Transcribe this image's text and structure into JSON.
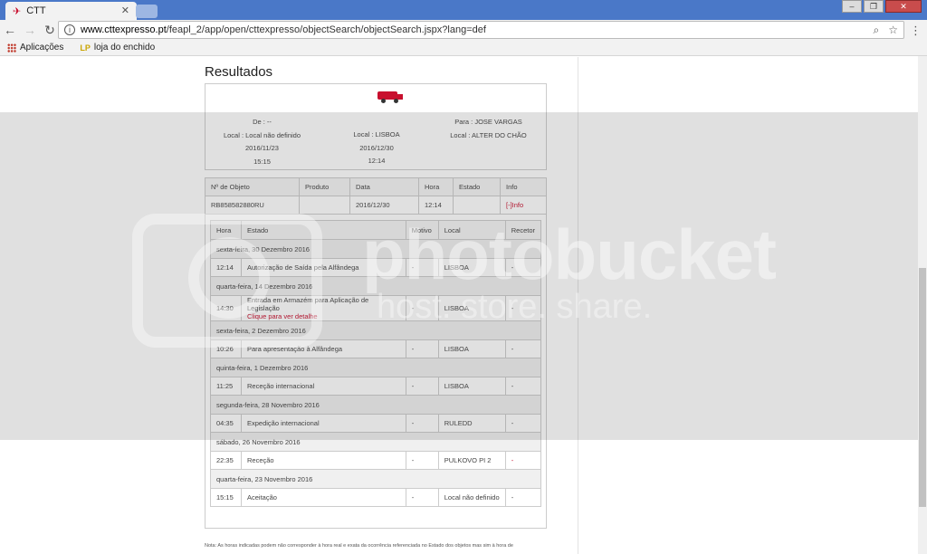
{
  "browser": {
    "tab_title": "CTT",
    "url_host": "www.cttexpresso.pt",
    "url_path": "/feapl_2/app/open/cttexpresso/objectSearch/objectSearch.jspx?lang=def",
    "bookmarks": [
      "Aplicações",
      "loja do enchido"
    ]
  },
  "page": {
    "title": "Resultados",
    "summary": {
      "origin": {
        "de": "De : --",
        "local": "Local : Local não definido",
        "date": "2016/11/23",
        "time": "15:15"
      },
      "current": {
        "local": "Local : LISBOA",
        "date": "2016/12/30",
        "time": "12:14"
      },
      "destination": {
        "para": "Para : JOSE VARGAS",
        "local": "Local : ALTER DO CHÃO"
      }
    },
    "object_table": {
      "headers": [
        "Nº de Objeto",
        "Produto",
        "Data",
        "Hora",
        "Estado",
        "Info"
      ],
      "row": [
        "RB858582880RU",
        "",
        "2016/12/30",
        "12:14",
        "",
        "[-]Info"
      ]
    },
    "detail_table": {
      "headers": [
        "Hora",
        "Estado",
        "Motivo",
        "Local",
        "Recetor"
      ],
      "groups": [
        {
          "day": "sexta-feira, 30 Dezembro 2016",
          "rows": [
            [
              "12:14",
              "Autorização de Saída pela Alfândega",
              "-",
              "LISBOA",
              "-"
            ]
          ]
        },
        {
          "day": "quarta-feira, 14 Dezembro 2016",
          "rows": [
            [
              "14:30",
              "Entrada em Armazém para Aplicação de Legislação",
              "-",
              "LISBOA",
              "-"
            ]
          ],
          "link": "Clique para ver detalhe"
        },
        {
          "day": "sexta-feira, 2 Dezembro 2016",
          "rows": [
            [
              "10:26",
              "Para apresentação à Alfândega",
              "-",
              "LISBOA",
              "-"
            ]
          ]
        },
        {
          "day": "quinta-feira, 1 Dezembro 2016",
          "rows": [
            [
              "11:25",
              "Receção internacional",
              "-",
              "LISBOA",
              "-"
            ]
          ]
        },
        {
          "day": "segunda-feira, 28 Novembro 2016",
          "rows": [
            [
              "04:35",
              "Expedição internacional",
              "-",
              "RULEDD",
              "-"
            ]
          ]
        },
        {
          "day": "sábado, 26 Novembro 2016",
          "rows": [
            [
              "22:35",
              "Receção",
              "-",
              "PULKOVO PI 2",
              "-"
            ]
          ]
        },
        {
          "day": "quarta-feira, 23 Novembro 2016",
          "rows": [
            [
              "15:15",
              "Aceitação",
              "-",
              "Local não definido",
              "-"
            ]
          ]
        }
      ]
    },
    "note": "Nota: As horas indicadas podem não corresponder à hora real e exata da ocorrência referenciada no Estado dos objetos mas sim à hora de"
  },
  "watermark": {
    "brand": "photobucket",
    "tagline": "host. store. share."
  },
  "colors": {
    "accent": "#c8102e",
    "titlebar": "#4a78c8"
  }
}
